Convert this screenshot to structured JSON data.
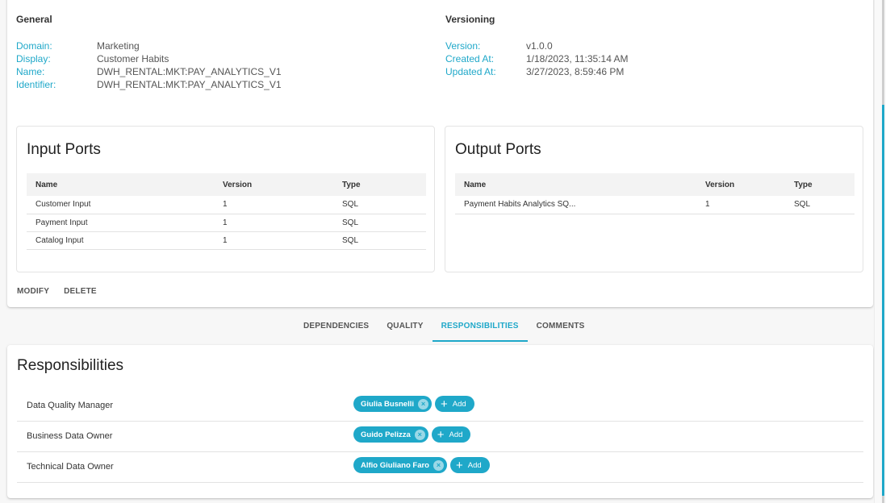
{
  "general": {
    "title": "General",
    "fields": [
      {
        "label": "Domain:",
        "value": "Marketing"
      },
      {
        "label": "Display:",
        "value": "Customer Habits"
      },
      {
        "label": "Name:",
        "value": "DWH_RENTAL:MKT:PAY_ANALYTICS_V1"
      },
      {
        "label": "Identifier:",
        "value": "DWH_RENTAL:MKT:PAY_ANALYTICS_V1"
      }
    ]
  },
  "versioning": {
    "title": "Versioning",
    "fields": [
      {
        "label": "Version:",
        "value": "v1.0.0"
      },
      {
        "label": "Created At:",
        "value": "1/18/2023, 11:35:14 AM"
      },
      {
        "label": "Updated At:",
        "value": "3/27/2023, 8:59:46 PM"
      }
    ]
  },
  "input_ports": {
    "title": "Input Ports",
    "columns": [
      "Name",
      "Version",
      "Type"
    ],
    "rows": [
      [
        "Customer Input",
        "1",
        "SQL"
      ],
      [
        "Payment Input",
        "1",
        "SQL"
      ],
      [
        "Catalog Input",
        "1",
        "SQL"
      ]
    ]
  },
  "output_ports": {
    "title": "Output Ports",
    "columns": [
      "Name",
      "Version",
      "Type"
    ],
    "rows": [
      [
        "Payment Habits Analytics SQ...",
        "1",
        "SQL"
      ]
    ]
  },
  "actions": {
    "modify": "MODIFY",
    "delete": "DELETE"
  },
  "tabs": [
    {
      "label": "DEPENDENCIES",
      "active": false
    },
    {
      "label": "QUALITY",
      "active": false
    },
    {
      "label": "RESPONSIBILITIES",
      "active": true
    },
    {
      "label": "COMMENTS",
      "active": false
    }
  ],
  "responsibilities": {
    "title": "Responsibilities",
    "add_label": "Add",
    "rows": [
      {
        "role": "Data Quality Manager",
        "people": [
          "Giulia Busnelli"
        ]
      },
      {
        "role": "Business Data Owner",
        "people": [
          "Guido Pelizza"
        ]
      },
      {
        "role": "Technical Data Owner",
        "people": [
          "Alfio Giuliano Faro"
        ]
      }
    ]
  },
  "icons": {
    "chip_remove": "×",
    "add": "+"
  },
  "colors": {
    "accent": "#1fa8c9"
  }
}
